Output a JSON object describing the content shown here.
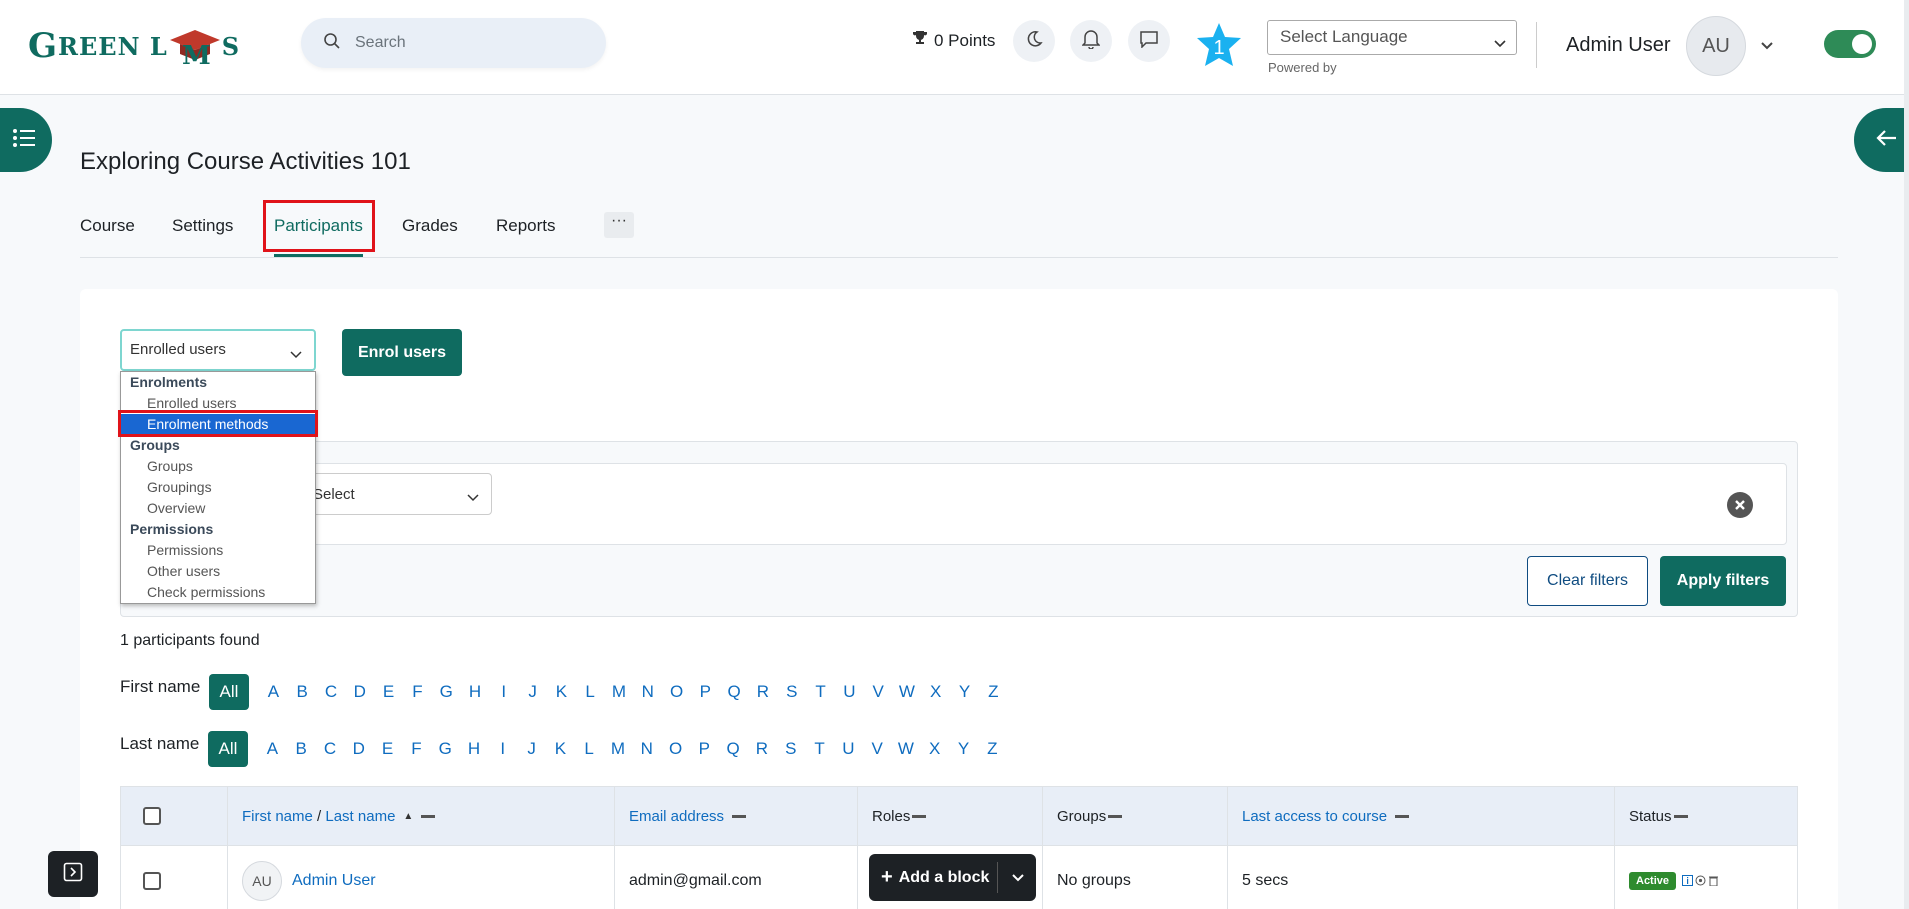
{
  "header": {
    "logo_text_start": "G",
    "logo_text_mid": "REEN L",
    "logo_text_end": "S",
    "search_placeholder": "Search",
    "points": "0 Points",
    "star_count": "1",
    "language_placeholder": "Select Language",
    "powered_by": "Powered by",
    "user_name": "Admin User",
    "user_initials": "AU"
  },
  "course": {
    "title": "Exploring Course Activities 101",
    "tabs": [
      {
        "label": "Course"
      },
      {
        "label": "Settings"
      },
      {
        "label": "Participants"
      },
      {
        "label": "Grades"
      },
      {
        "label": "Reports"
      }
    ],
    "more_label": "···"
  },
  "participants": {
    "select_value": "Enrolled users",
    "enrol_button": "Enrol users",
    "filter_select_value": "Select",
    "clear_filters": "Clear filters",
    "apply_filters": "Apply filters",
    "found_text": "1 participants found",
    "first_name_label": "First name",
    "last_name_label": "Last name",
    "all_label": "All",
    "letters": [
      "A",
      "B",
      "C",
      "D",
      "E",
      "F",
      "G",
      "H",
      "I",
      "J",
      "K",
      "L",
      "M",
      "N",
      "O",
      "P",
      "Q",
      "R",
      "S",
      "T",
      "U",
      "V",
      "W",
      "X",
      "Y",
      "Z"
    ]
  },
  "dropdown": {
    "groups": [
      {
        "label": "Enrolments",
        "items": [
          "Enrolled users",
          "Enrolment methods"
        ]
      },
      {
        "label": "Groups",
        "items": [
          "Groups",
          "Groupings",
          "Overview"
        ]
      },
      {
        "label": "Permissions",
        "items": [
          "Permissions",
          "Other users",
          "Check permissions"
        ]
      }
    ],
    "selected": "Enrolment methods"
  },
  "table": {
    "headers": {
      "first_name": "First name",
      "slash": " / ",
      "last_name": "Last name",
      "email": "Email address",
      "roles": "Roles",
      "groups": "Groups",
      "last_access": "Last access to course",
      "status": "Status"
    },
    "rows": [
      {
        "initials": "AU",
        "name": "Admin User",
        "email": "admin@gmail.com",
        "groups": "No groups",
        "last_access": "5 secs",
        "status": "Active"
      }
    ]
  },
  "add_block": {
    "label": "Add a block"
  },
  "colors": {
    "primary": "#0f6b60",
    "link": "#0f6cbf",
    "highlight": "#e0131a",
    "selected": "#1967d2"
  }
}
